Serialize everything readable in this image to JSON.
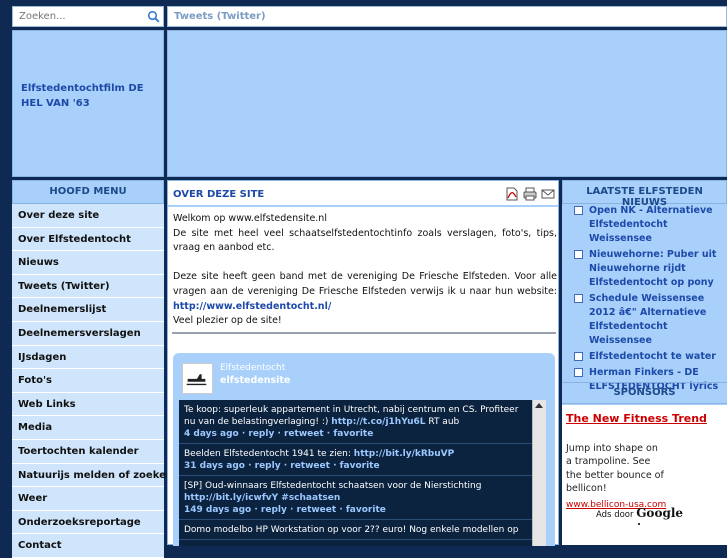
{
  "search": {
    "placeholder": "Zoeken..."
  },
  "tweets_bar": {
    "title": "Tweets (Twitter)"
  },
  "banner": {
    "left_text": "Elfstedentochtfilm DE HEL VAN '63"
  },
  "menu": {
    "header": "HOOFD MENU",
    "items": [
      "Over deze site",
      "Over Elfstedentocht",
      "Nieuws",
      "Tweets (Twitter)",
      "Deelnemerslijst",
      "Deelnemersverslagen",
      "IJsdagen",
      "Foto's",
      "Web Links",
      "Media",
      "Toertochten kalender",
      "Natuurijs melden of zoeken",
      "Weer",
      "Onderzoeksreportage",
      "Contact"
    ]
  },
  "content": {
    "title": "OVER DEZE SITE",
    "intro_1": "Welkom op www.elfstedensite.nl",
    "intro_2": "De site met heel veel schaatselfstedentochtinfo zoals verslagen, foto's, tips, vraag en aanbod etc.",
    "intro_3": "Deze site heeft geen band met de vereniging De Friesche Elfsteden. Voor alle vragen aan de vereniging De Friesche Elfsteden verwijs ik u naar hun website:",
    "link": "http://www.elfstedentocht.nl/",
    "outro": "Veel plezier op de site!"
  },
  "twitter": {
    "name": "Elfstedentocht",
    "user": "elfstedensite",
    "tweets": [
      {
        "text": "Te koop: superleuk appartement in Utrecht, nabij centrum en CS. Profiteer nu van de belastingverlaging! :)",
        "link": "http://t.co/j1hYu6L",
        "tail": " RT aub",
        "meta": "4 days ago · reply · retweet · favorite"
      },
      {
        "text": "Beelden Elfstedentocht 1941 te zien:",
        "link": "http://bit.ly/kRbuVP",
        "tail": "",
        "meta": "31 days ago · reply · retweet · favorite"
      },
      {
        "text": "[SP] Oud-winnaars Elfstedentocht schaatsen voor de Nierstichting",
        "link": "http://bit.ly/icwfvY #schaatsen",
        "tail": "",
        "meta": "149 days ago · reply · retweet · favorite"
      },
      {
        "text": "Domo modelbo HP Workstation op voor 2?? euro! Nog enkele modellen op",
        "link": "",
        "tail": "",
        "meta": ""
      }
    ]
  },
  "right": {
    "news_header": "LAATSTE ELFSTEDEN NIEUWS",
    "news": [
      "Open NK - Alternatieve Elfstedentocht Weissensee",
      "Nieuwehorne: Puber uit Nieuwehorne rijdt Elfstedentocht op pony",
      "Schedule Weissensee 2012 â€\" Alternatieve Elfstedentocht Weissensee",
      "Elfstedentocht te water",
      "Herman Finkers - DE ELFSTEDENTOCHT lyrics"
    ],
    "sponsors_header": "SPONSORS",
    "ad": {
      "headline": "The New Fitness Trend",
      "body": "Jump into shape on a trampoline. See the better bounce of bellicon!",
      "url": "www.bellicon-usa.com",
      "by": "Ads door",
      "google": "Google"
    }
  }
}
